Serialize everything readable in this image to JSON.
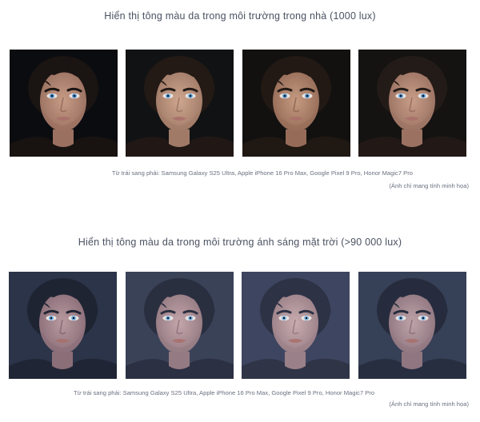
{
  "indoor": {
    "heading": "Hiển thị tông màu da trong môi trường trong nhà (1000 lux)",
    "caption": "Từ trái sang phải: Samsung Galaxy S25 Ultra, Apple iPhone 16 Pro Max, Google Pixel 9 Pro, Honor Magic7 Pro",
    "note": "(Ảnh chỉ mang tính minh họa)",
    "photos": [
      {
        "device": "Samsung Galaxy S25 Ultra",
        "bg": "#0b0c10",
        "skin": "#c79c86",
        "skin_shade": "#9a7060",
        "hair": "#1a1412",
        "eye": "#4a8fd0"
      },
      {
        "device": "Apple iPhone 16 Pro Max",
        "bg": "#111214",
        "skin": "#cfa78f",
        "skin_shade": "#a07a67",
        "hair": "#231a16",
        "eye": "#5a9fd8"
      },
      {
        "device": "Google Pixel 9 Pro",
        "bg": "#121110",
        "skin": "#c49a80",
        "skin_shade": "#966c58",
        "hair": "#221914",
        "eye": "#4f93cc"
      },
      {
        "device": "Honor Magic7 Pro",
        "bg": "#141312",
        "skin": "#c89e88",
        "skin_shade": "#9b7262",
        "hair": "#231b17",
        "eye": "#5597d2"
      }
    ]
  },
  "outdoor": {
    "heading": "Hiển thị tông màu da trong môi trường ánh sáng mặt trời (>90 000 lux)",
    "caption": "Từ trái sang phải: Samsung Galaxy S25 Ultra, Apple iPhone 16 Pro Max, Google Pixel 9 Pro, Honor Magic7 Pro",
    "note": "(Ảnh chỉ mang tính minh họa)",
    "photos": [
      {
        "device": "Samsung Galaxy S25 Ultra",
        "bg": "#2b3448",
        "skin": "#b99aa0",
        "skin_shade": "#8a6e78",
        "hair": "#1f2433",
        "eye": "#6aa8e0"
      },
      {
        "device": "Apple iPhone 16 Pro Max",
        "bg": "#3a4258",
        "skin": "#c3a6aa",
        "skin_shade": "#947a82",
        "hair": "#2a2f40",
        "eye": "#78b0e2"
      },
      {
        "device": "Google Pixel 9 Pro",
        "bg": "#3d4560",
        "skin": "#c8acae",
        "skin_shade": "#9a8088",
        "hair": "#2d3245",
        "eye": "#7ab2e0"
      },
      {
        "device": "Honor Magic7 Pro",
        "bg": "#364057",
        "skin": "#bea3a8",
        "skin_shade": "#8f7680",
        "hair": "#262c3d",
        "eye": "#74ace0"
      }
    ]
  }
}
